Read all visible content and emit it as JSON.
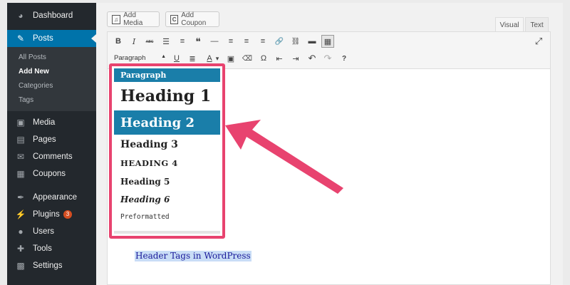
{
  "sidebar": {
    "items_top": [
      {
        "label": "Dashboard",
        "icon": "dashboard-icon",
        "glyph": "◕"
      },
      {
        "label": "Posts",
        "icon": "pin-icon",
        "glyph": "✎",
        "active": true
      }
    ],
    "submenu": [
      {
        "label": "All Posts",
        "current": false
      },
      {
        "label": "Add New",
        "current": true
      },
      {
        "label": "Categories",
        "current": false
      },
      {
        "label": "Tags",
        "current": false
      }
    ],
    "items_bottom": [
      {
        "label": "Media",
        "icon": "media-icon",
        "glyph": "▣"
      },
      {
        "label": "Pages",
        "icon": "pages-icon",
        "glyph": "▤"
      },
      {
        "label": "Comments",
        "icon": "comments-icon",
        "glyph": "✉"
      },
      {
        "label": "Coupons",
        "icon": "coupons-icon",
        "glyph": "▦"
      },
      {
        "label": "Appearance",
        "icon": "appearance-icon",
        "glyph": "✒"
      },
      {
        "label": "Plugins",
        "icon": "plugins-icon",
        "glyph": "⚡",
        "badge": "3"
      },
      {
        "label": "Users",
        "icon": "users-icon",
        "glyph": "●"
      },
      {
        "label": "Tools",
        "icon": "tools-icon",
        "glyph": "✚"
      },
      {
        "label": "Settings",
        "icon": "settings-icon",
        "glyph": "▩"
      }
    ]
  },
  "buttons": {
    "add_media": "Add Media",
    "add_coupon": "Add Coupon",
    "coupon_glyph": "C"
  },
  "tabs": {
    "visual": "Visual",
    "text": "Text"
  },
  "toolbar": {
    "format_value": "Paragraph",
    "row1": [
      {
        "name": "bold-button",
        "glyph": "B"
      },
      {
        "name": "italic-button",
        "glyph": "I"
      },
      {
        "name": "strikethrough-button",
        "glyph": "ᴀʙᴄ"
      },
      {
        "name": "bulleted-list-button",
        "glyph": "☰"
      },
      {
        "name": "numbered-list-button",
        "glyph": "≡"
      },
      {
        "name": "blockquote-button",
        "glyph": "❝"
      },
      {
        "name": "horizontal-line-button",
        "glyph": "—"
      },
      {
        "name": "align-left-button",
        "glyph": "≡"
      },
      {
        "name": "align-center-button",
        "glyph": "≡"
      },
      {
        "name": "align-right-button",
        "glyph": "≡"
      },
      {
        "name": "insert-link-button",
        "glyph": "🔗"
      },
      {
        "name": "remove-link-button",
        "glyph": "⛓"
      },
      {
        "name": "read-more-button",
        "glyph": "▬"
      },
      {
        "name": "toolbar-toggle-button",
        "glyph": "▦",
        "pressed": true
      }
    ],
    "row2": [
      {
        "name": "underline-button",
        "glyph": "U"
      },
      {
        "name": "justify-button",
        "glyph": "≣"
      },
      {
        "name": "text-color-button",
        "glyph": "A"
      },
      {
        "name": "text-color-dropdown",
        "glyph": "▾"
      },
      {
        "name": "paste-as-text-button",
        "glyph": "▣"
      },
      {
        "name": "clear-formatting-button",
        "glyph": "⌫"
      },
      {
        "name": "special-character-button",
        "glyph": "Ω"
      },
      {
        "name": "decrease-indent-button",
        "glyph": "⇤"
      },
      {
        "name": "increase-indent-button",
        "glyph": "⇥"
      },
      {
        "name": "undo-button",
        "glyph": "↶"
      },
      {
        "name": "redo-button",
        "glyph": "↷"
      },
      {
        "name": "help-button",
        "glyph": "?"
      }
    ],
    "fullscreen_glyph": "⤢"
  },
  "format_dropdown": {
    "items": [
      "Paragraph",
      "Heading 1",
      "Heading 2",
      "Heading 3",
      "Heading 4",
      "Heading 5",
      "Heading 6",
      "Preformatted"
    ],
    "selected": "Heading 2"
  },
  "content": {
    "selected_text": "Header Tags in WordPress"
  },
  "colors": {
    "sidebar_bg": "#23282d",
    "active_blue": "#0073aa",
    "highlight_pink": "#e8436f",
    "selection_bg": "#c9ddf6"
  }
}
